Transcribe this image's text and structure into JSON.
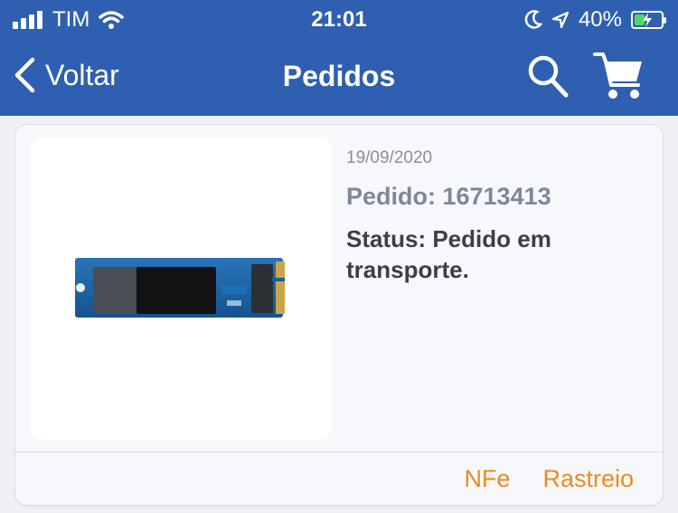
{
  "status_bar": {
    "carrier": "TIM",
    "time": "21:01",
    "battery_text": "40%",
    "battery_level": 0.4
  },
  "nav": {
    "back_label": "Voltar",
    "title": "Pedidos"
  },
  "order": {
    "date": "19/09/2020",
    "number": "Pedido: 16713413",
    "status": "Status: Pedido em transporte.",
    "actions": {
      "nfe": "NFe",
      "tracking": "Rastreio"
    }
  },
  "colors": {
    "header": "#2f5fb0",
    "accent": "#f0891a",
    "ssd_board": "#1f65a8",
    "ssd_chip": "#111214"
  },
  "icons": [
    "signal-icon",
    "wifi-icon",
    "moon-icon",
    "location-arrow-icon",
    "battery-icon",
    "chevron-left-icon",
    "search-icon",
    "cart-icon"
  ]
}
